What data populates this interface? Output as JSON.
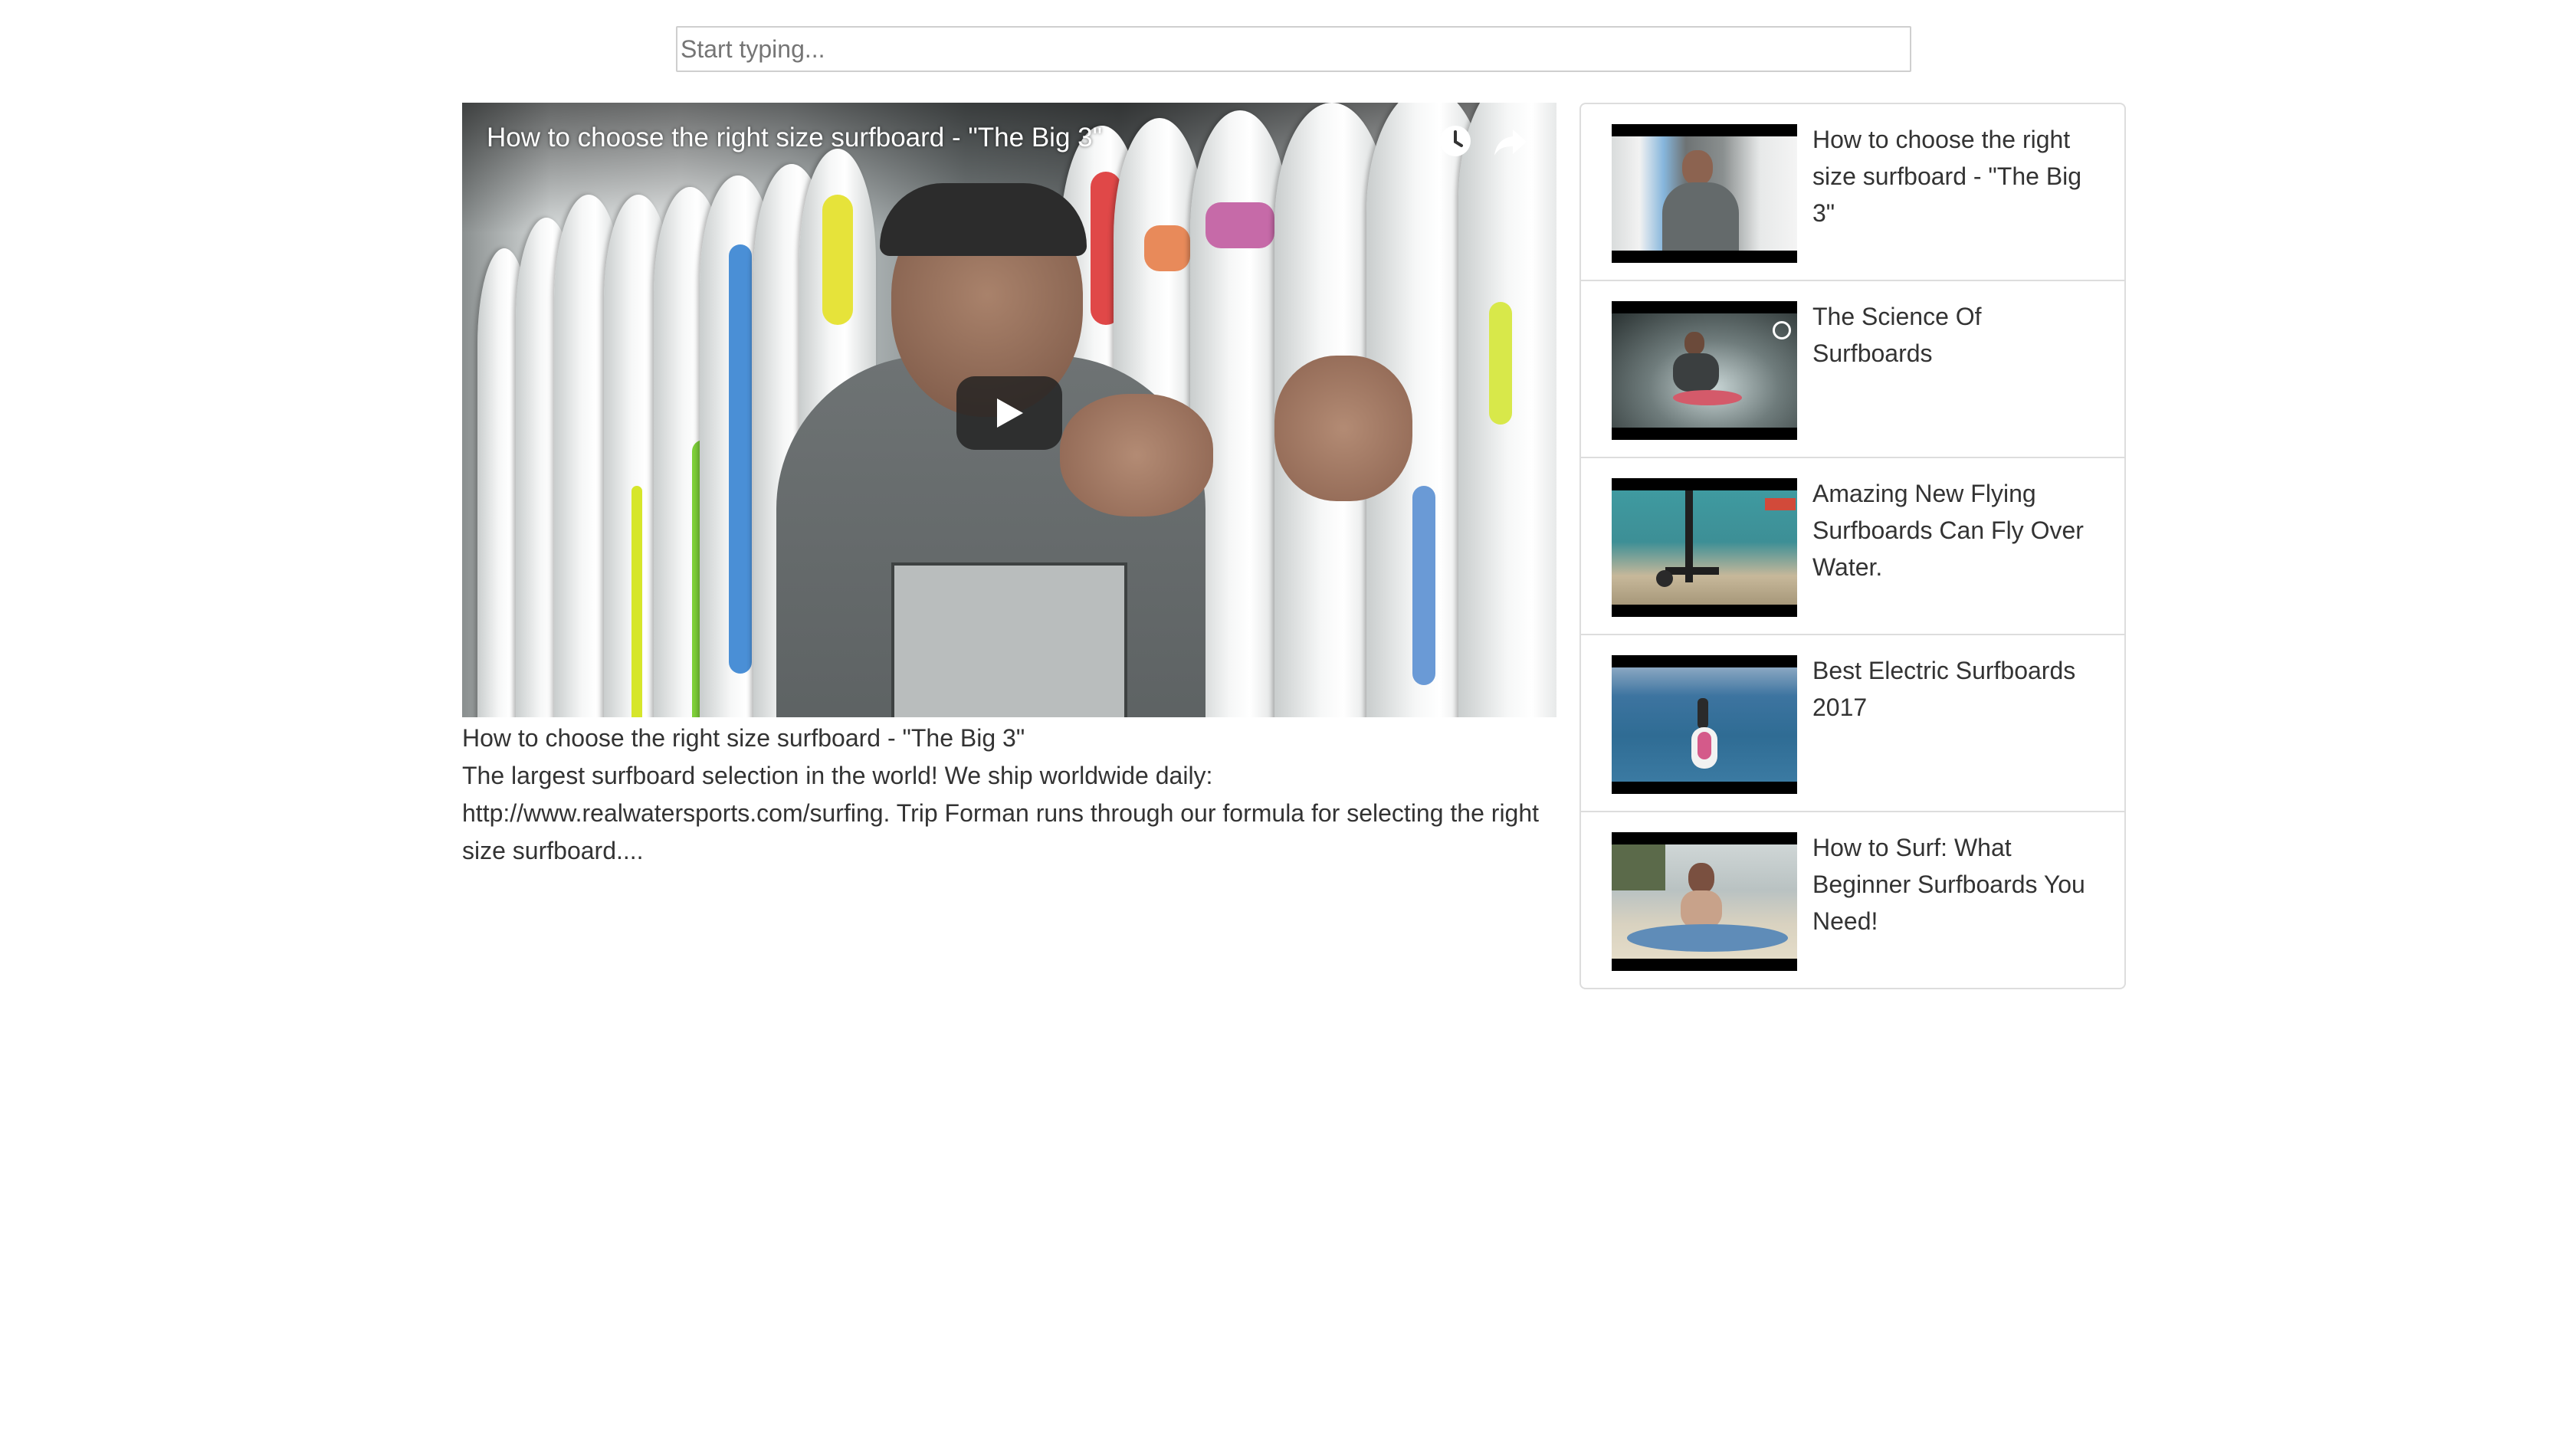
{
  "search": {
    "placeholder": "Start typing..."
  },
  "player": {
    "title": "How to choose the right size surfboard - \"The Big 3\"",
    "icons": [
      "watch-later-icon",
      "share-icon",
      "play-icon"
    ]
  },
  "selected_video": {
    "title": "How to choose the right size surfboard - \"The Big 3\"",
    "description": "The largest surfboard selection in the world! We ship worldwide daily: http://www.realwatersports.com/surfing. Trip Forman runs through our formula for selecting the right size surfboard...."
  },
  "video_list": [
    {
      "title": "How to choose the right size surfboard - \"The Big 3\""
    },
    {
      "title": "The Science Of Surfboards"
    },
    {
      "title": "Amazing New Flying Surfboards Can Fly Over Water."
    },
    {
      "title": "Best Electric Surfboards 2017"
    },
    {
      "title": "How to Surf: What Beginner Surfboards You Need!"
    }
  ],
  "colors": {
    "text": "#333333",
    "border": "#dddddd",
    "play_button": "#212121"
  }
}
